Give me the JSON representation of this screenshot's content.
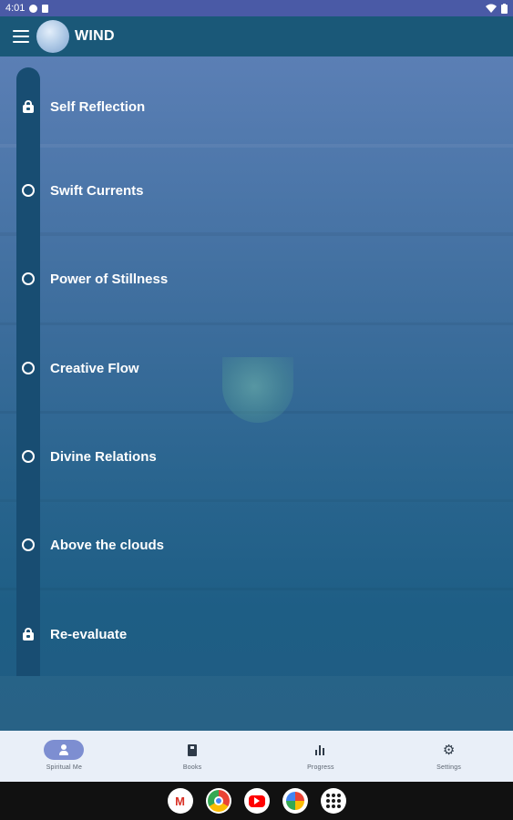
{
  "status_bar": {
    "time": "4:01"
  },
  "app_bar": {
    "title": "WIND"
  },
  "lessons": [
    {
      "label": "Self Reflection",
      "state": "locked"
    },
    {
      "label": "Swift Currents",
      "state": "open"
    },
    {
      "label": "Power of Stillness",
      "state": "open"
    },
    {
      "label": "Creative Flow",
      "state": "open"
    },
    {
      "label": "Divine Relations",
      "state": "open"
    },
    {
      "label": "Above the clouds",
      "state": "open"
    },
    {
      "label": "Re-evaluate",
      "state": "locked"
    }
  ],
  "bottom_nav": {
    "items": [
      {
        "label": "Spiritual Me",
        "icon": "person-icon",
        "active": true
      },
      {
        "label": "Books",
        "icon": "book-icon",
        "active": false
      },
      {
        "label": "Progress",
        "icon": "bar-chart-icon",
        "active": false
      },
      {
        "label": "Settings",
        "icon": "gear-icon",
        "active": false
      }
    ]
  },
  "dock": {
    "apps": [
      "gmail-icon",
      "chrome-icon",
      "youtube-icon",
      "photos-icon",
      "app-drawer-icon"
    ]
  },
  "colors": {
    "status_bar": "#4a5aa6",
    "app_bar": "#1a5878",
    "track": "#184d72",
    "nav_active": "#7d8ed1",
    "bottom_nav_bg": "#e9eff8"
  }
}
